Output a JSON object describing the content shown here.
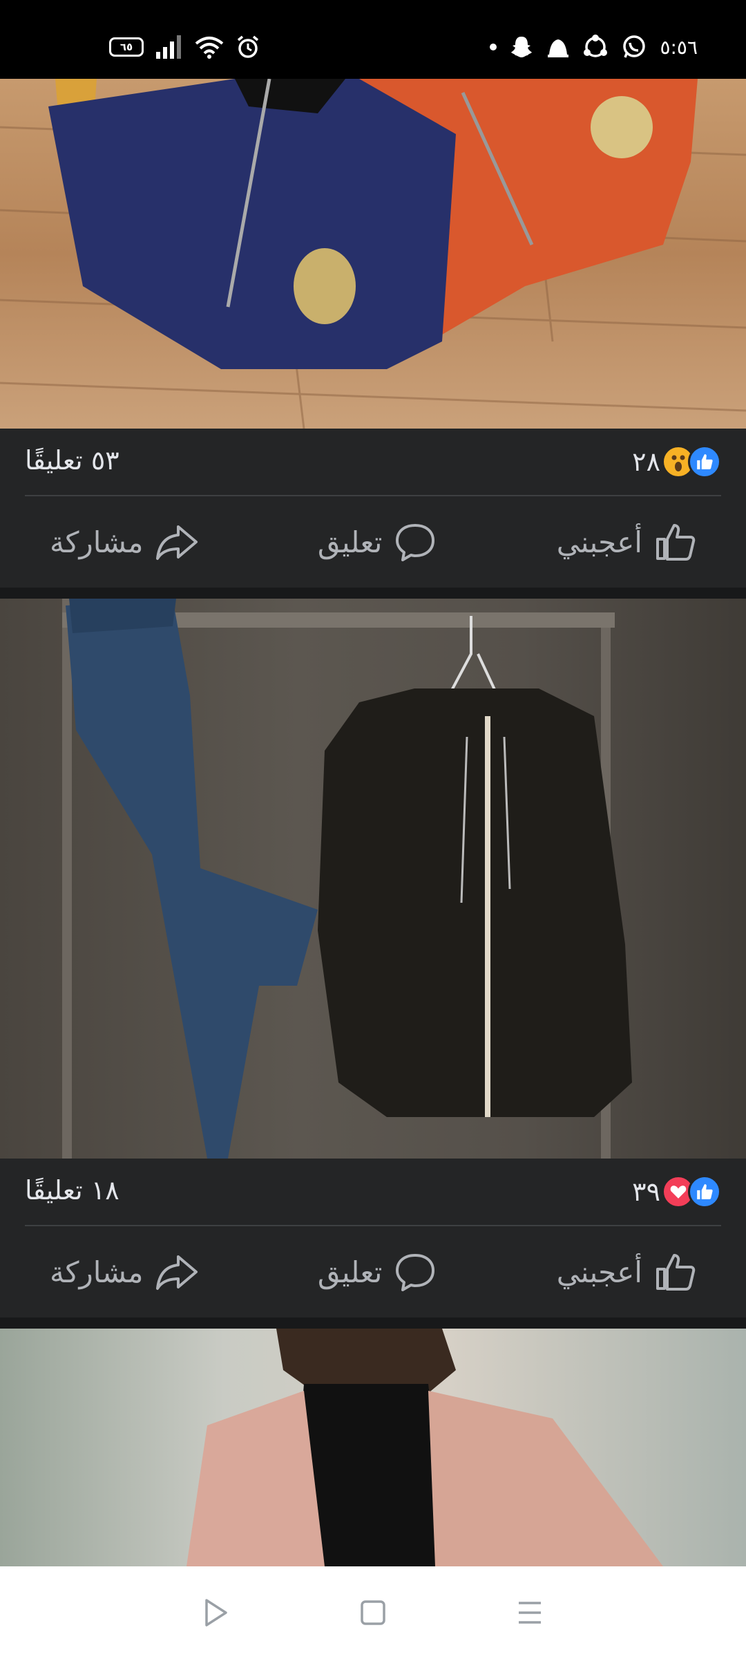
{
  "status_bar": {
    "time": "٥:٥٦",
    "battery": "٦٥"
  },
  "posts": [
    {
      "reaction_count": "٢٨",
      "comments": "٥٣ تعليقًا",
      "like_label": "أعجبني",
      "comment_label": "تعليق",
      "share_label": "مشاركة"
    },
    {
      "reaction_count": "٣٩",
      "comments": "١٨ تعليقًا",
      "like_label": "أعجبني",
      "comment_label": "تعليق",
      "share_label": "مشاركة"
    }
  ],
  "colors": {
    "like_blue": "#2e89ff",
    "love_red": "#f33e58",
    "wow_yellow": "#f7b125",
    "card_bg": "#242526"
  }
}
